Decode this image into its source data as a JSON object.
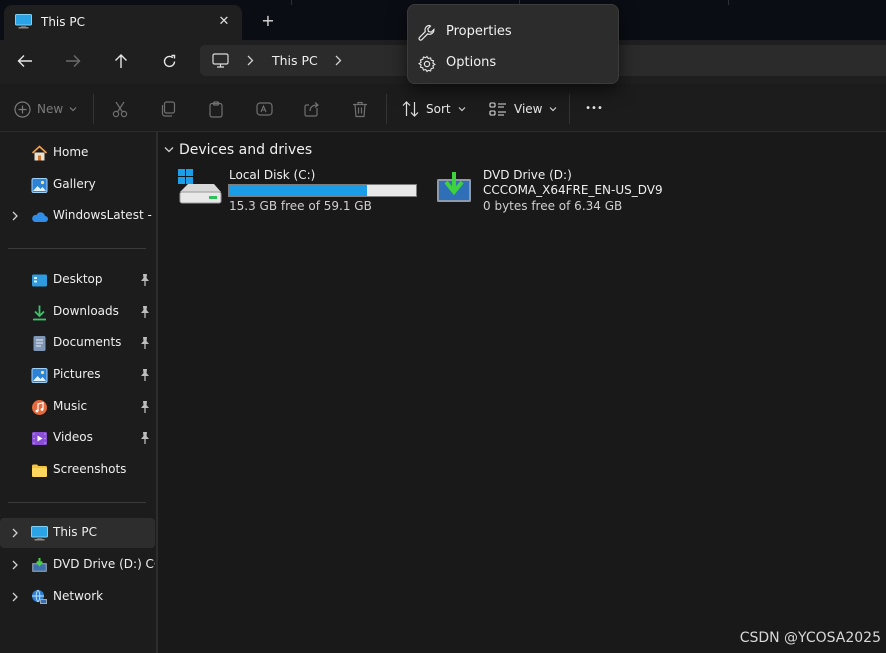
{
  "window": {
    "tab_title": "This PC",
    "close_glyph": "✕",
    "new_tab_glyph": "+"
  },
  "address_bar": {
    "crumbs": [
      "This PC"
    ]
  },
  "toolbar": {
    "new_label": "New",
    "sort_label": "Sort",
    "view_label": "View",
    "more_glyph": "•••"
  },
  "sidebar": {
    "home": "Home",
    "gallery": "Gallery",
    "onedrive": "WindowsLatest - Pe",
    "desktop": "Desktop",
    "downloads": "Downloads",
    "documents": "Documents",
    "pictures": "Pictures",
    "music": "Music",
    "videos": "Videos",
    "screenshots": "Screenshots",
    "this_pc": "This PC",
    "dvd_drive": "DVD Drive (D:) CCC",
    "network": "Network"
  },
  "content": {
    "group_label": "Devices and drives",
    "drives": [
      {
        "name": "Local Disk (C:)",
        "free": "15.3 GB free of 59.1 GB",
        "used_fraction": 0.74
      },
      {
        "name": "DVD Drive (D:)",
        "label": "CCCOMA_X64FRE_EN-US_DV9",
        "free": "0 bytes free of 6.34 GB"
      }
    ]
  },
  "context_menu": {
    "items": [
      {
        "label": "Properties",
        "icon": "wrench-icon"
      },
      {
        "label": "Options",
        "icon": "gear-icon"
      }
    ]
  },
  "watermark": "CSDN @YCOSA2025",
  "colors": {
    "accent": "#1b9ce6",
    "background": "#191919",
    "folder_yellow": "#f2c33b"
  }
}
